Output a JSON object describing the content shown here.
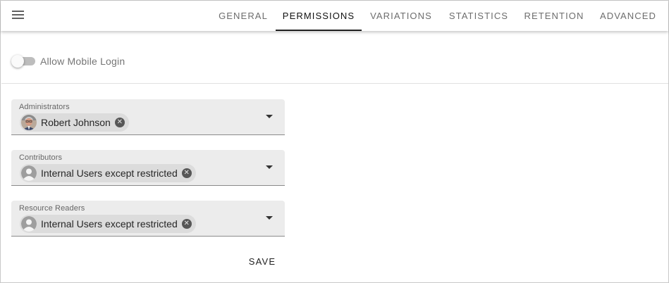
{
  "header": {
    "tabs": [
      {
        "label": "GENERAL",
        "active": false
      },
      {
        "label": "PERMISSIONS",
        "active": true
      },
      {
        "label": "VARIATIONS",
        "active": false
      },
      {
        "label": "STATISTICS",
        "active": false
      },
      {
        "label": "RETENTION",
        "active": false
      },
      {
        "label": "ADVANCED",
        "active": false
      }
    ]
  },
  "mobile_login": {
    "label": "Allow Mobile Login",
    "enabled": false
  },
  "fields": [
    {
      "label": "Administrators",
      "chips": [
        {
          "text": "Robert Johnson",
          "avatar": "user-photo"
        }
      ]
    },
    {
      "label": "Contributors",
      "chips": [
        {
          "text": "Internal Users except restricted",
          "avatar": "default-user-icon"
        }
      ]
    },
    {
      "label": "Resource Readers",
      "chips": [
        {
          "text": "Internal Users except restricted",
          "avatar": "default-user-icon"
        }
      ]
    }
  ],
  "actions": {
    "save_label": "SAVE"
  },
  "colors": {
    "tab_indicator": "#212121",
    "field_background": "#ececec",
    "chip_background": "#dcdcdc",
    "toggle_track": "#bdbdbd"
  }
}
